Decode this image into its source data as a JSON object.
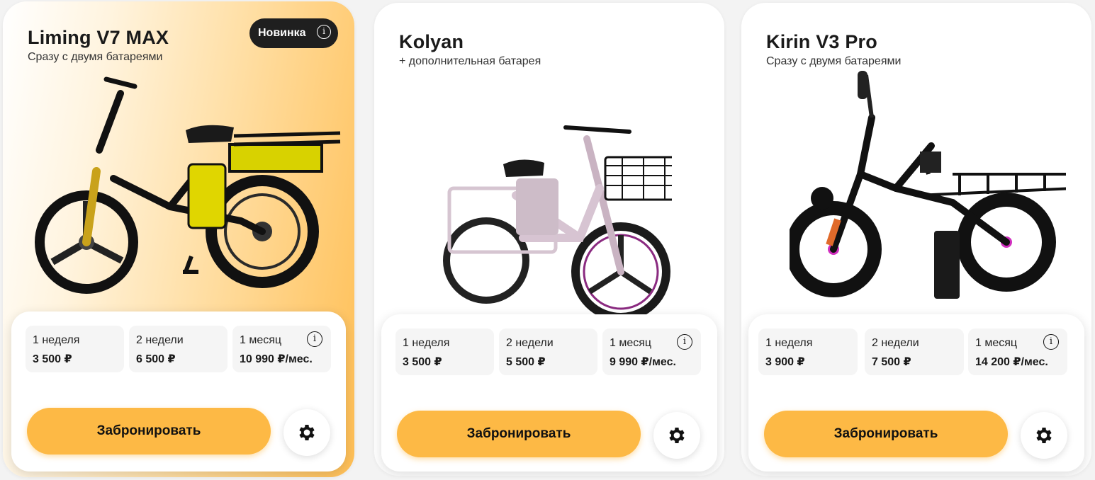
{
  "cards": [
    {
      "title": "Liming V7 MAX",
      "subtitle": "Сразу с двумя батареями",
      "badge": "Новинка",
      "prices": [
        {
          "period": "1 неделя",
          "amount": "3 500 ₽"
        },
        {
          "period": "2 недели",
          "amount": "6 500 ₽"
        },
        {
          "period": "1 месяц",
          "amount": "10 990 ₽/мес."
        }
      ],
      "book_label": "Забронировать"
    },
    {
      "title": "Kolyan",
      "subtitle": "+ дополнительная батарея",
      "prices": [
        {
          "period": "1 неделя",
          "amount": "3 500 ₽"
        },
        {
          "period": "2 недели",
          "amount": "5 500 ₽"
        },
        {
          "period": "1 месяц",
          "amount": "9 990 ₽/мес."
        }
      ],
      "book_label": "Забронировать"
    },
    {
      "title": "Kirin V3 Pro",
      "subtitle": "Сразу с двумя батареями",
      "prices": [
        {
          "period": "1 неделя",
          "amount": "3 900 ₽"
        },
        {
          "period": "2 недели",
          "amount": "7 500 ₽"
        },
        {
          "period": "1 месяц",
          "amount": "14 200 ₽/мес."
        }
      ],
      "book_label": "Забронировать"
    }
  ],
  "colors": {
    "accent": "#fdb945",
    "badge_bg": "#1f1f1f"
  },
  "icons": {
    "info": "info-icon",
    "settings": "gear-icon"
  },
  "info_glyph": "i"
}
